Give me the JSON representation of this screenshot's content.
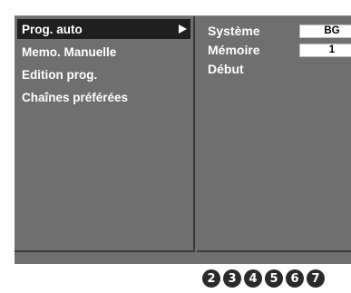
{
  "menu": {
    "items": [
      {
        "label": "Prog. auto",
        "selected": true
      },
      {
        "label": "Memo. Manuelle"
      },
      {
        "label": "Edition prog."
      },
      {
        "label": "Chaînes préférées"
      }
    ]
  },
  "settings": {
    "rows": [
      {
        "label": "Système",
        "value": "BG"
      },
      {
        "label": "Mémoire",
        "value": "1"
      },
      {
        "label": "Début"
      }
    ]
  },
  "callouts": [
    "2",
    "3",
    "4",
    "5",
    "6",
    "7"
  ],
  "icons": {
    "submenu_arrow": "right-triangle"
  },
  "colors": {
    "panel_bg": "#6f6f6f",
    "selected_bg": "#1f1f1f",
    "text": "#ffffff",
    "value_bg": "#ffffff",
    "callout_bg": "#2a2a2a"
  }
}
